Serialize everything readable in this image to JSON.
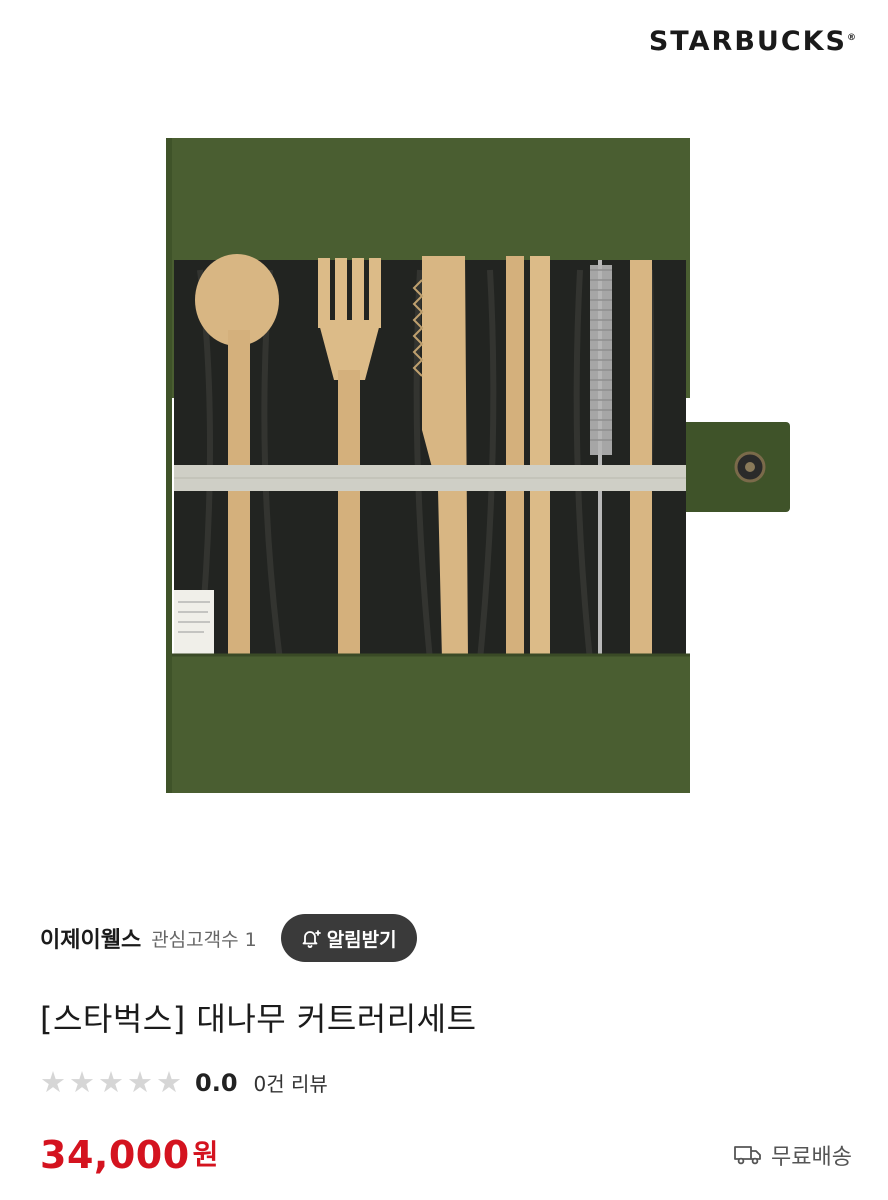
{
  "brand": {
    "logo_text": "STARBUCKS",
    "logo_mark": "®"
  },
  "seller": {
    "name": "이제이웰스",
    "follower_label": "관심고객수",
    "follower_count": "1",
    "notify_label": "알림받기",
    "notify_icon": "bell-plus-icon"
  },
  "product": {
    "title": "[스타벅스] 대나무 커트러리세트",
    "rating": {
      "score": "0.0",
      "stars_filled": 0,
      "stars_total": 5,
      "review_text": "0건 리뷰"
    },
    "price": {
      "amount": "34,000",
      "unit": "원"
    },
    "shipping": {
      "label": "무료배송",
      "icon": "truck-icon"
    }
  },
  "colors": {
    "price": "#d4131f",
    "notify_bg": "#3a3a3a",
    "star_empty": "#d6d6d6",
    "pouch_green": "#3f5329"
  }
}
